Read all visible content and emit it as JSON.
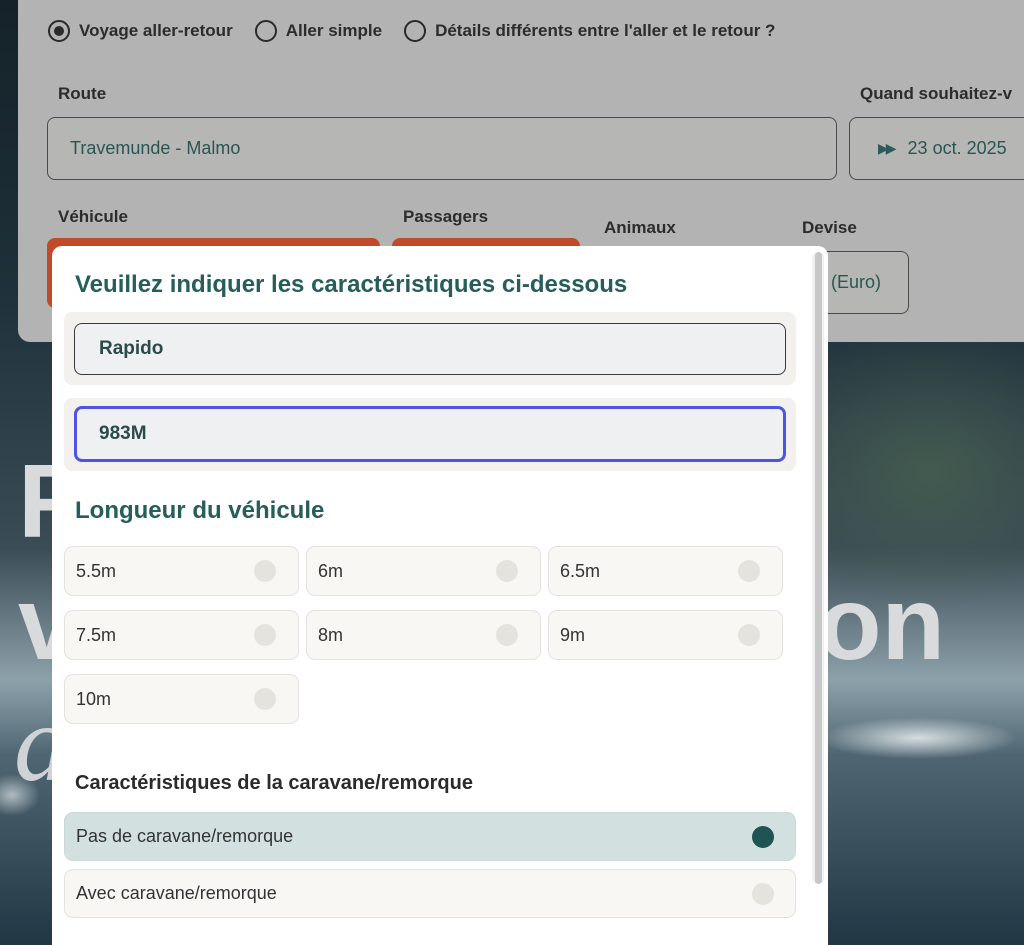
{
  "hero": {
    "line1": "F",
    "line2": "v",
    "line2_end": "on",
    "line3": "a"
  },
  "trip_type": {
    "options": [
      {
        "label": "Voyage aller-retour",
        "checked": true
      },
      {
        "label": "Aller simple",
        "checked": false
      },
      {
        "label": "Détails différents entre l'aller et le retour ?",
        "checked": false
      }
    ]
  },
  "route": {
    "label": "Route",
    "value": "Travemunde - Malmo"
  },
  "date": {
    "label": "Quand souhaitez-v",
    "value": "23 oct. 2025"
  },
  "vehicle": {
    "label": "Véhicule"
  },
  "passengers": {
    "label": "Passagers"
  },
  "animals": {
    "label": "Animaux"
  },
  "currency": {
    "label": "Devise",
    "value": "(Euro)"
  },
  "modal": {
    "title": "Veuillez indiquer les caractéristiques ci-dessous",
    "make_input": {
      "value": "Rapido"
    },
    "model_input": {
      "value": "983M"
    },
    "length_title": "Longueur du véhicule",
    "lengths": [
      {
        "label": "5.5m",
        "selected": false
      },
      {
        "label": "6m",
        "selected": false
      },
      {
        "label": "6.5m",
        "selected": false
      },
      {
        "label": "7.5m",
        "selected": false
      },
      {
        "label": "8m",
        "selected": false
      },
      {
        "label": "9m",
        "selected": false
      },
      {
        "label": "10m",
        "selected": false
      }
    ],
    "trailer_title": "Caractéristiques de la caravane/remorque",
    "trailer_options": [
      {
        "label": "Pas de caravane/remorque",
        "selected": true
      },
      {
        "label": "Avec caravane/remorque",
        "selected": false
      }
    ]
  },
  "colors": {
    "accent_teal": "#275d5a",
    "focus_blue": "#4e55e3",
    "cta_red": "#c04a2c",
    "selected_bg": "#d2e0e0"
  }
}
